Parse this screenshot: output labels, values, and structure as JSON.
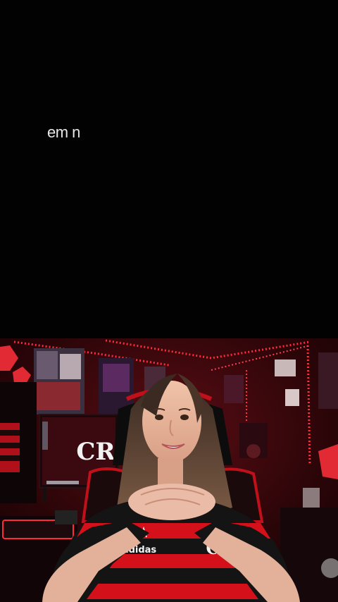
{
  "caption": {
    "text": "em n"
  },
  "scene": {
    "jersey_brand": "adidas",
    "accent_red": "#d4101b",
    "led_red": "#ff2a3a",
    "jersey_black": "#141414"
  }
}
